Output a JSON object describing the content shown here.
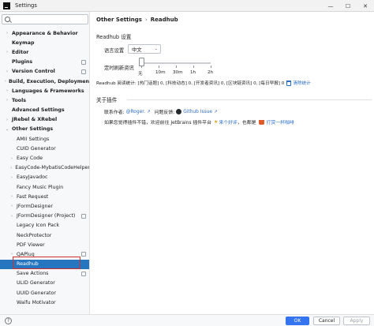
{
  "window": {
    "title": "Settings",
    "minimize_glyph": "—",
    "maximize_glyph": "☐",
    "close_glyph": "✕"
  },
  "sidebar": {
    "search": {
      "value": "",
      "placeholder": "Q"
    },
    "items": [
      {
        "label": "Appearance & Behavior",
        "bold": true,
        "level": 0,
        "arrow": "›",
        "project": false
      },
      {
        "label": "Keymap",
        "bold": true,
        "level": 0,
        "arrow": "",
        "project": false
      },
      {
        "label": "Editor",
        "bold": true,
        "level": 0,
        "arrow": "›",
        "project": false
      },
      {
        "label": "Plugins",
        "bold": true,
        "level": 0,
        "arrow": "",
        "project": true
      },
      {
        "label": "Version Control",
        "bold": true,
        "level": 0,
        "arrow": "›",
        "project": true
      },
      {
        "label": "Build, Execution, Deployment",
        "bold": true,
        "level": 0,
        "arrow": "›",
        "project": false
      },
      {
        "label": "Languages & Frameworks",
        "bold": true,
        "level": 0,
        "arrow": "›",
        "project": false
      },
      {
        "label": "Tools",
        "bold": true,
        "level": 0,
        "arrow": "›",
        "project": false
      },
      {
        "label": "Advanced Settings",
        "bold": true,
        "level": 0,
        "arrow": "",
        "project": false
      },
      {
        "label": "JRebel & XRebel",
        "bold": true,
        "level": 0,
        "arrow": "›",
        "project": false
      },
      {
        "label": "Other Settings",
        "bold": true,
        "level": 0,
        "arrow": "⌄",
        "project": false
      },
      {
        "label": "AMII Settings",
        "bold": false,
        "level": 1,
        "arrow": "",
        "project": false
      },
      {
        "label": "CUID Generator",
        "bold": false,
        "level": 1,
        "arrow": "",
        "project": false
      },
      {
        "label": "Easy Code",
        "bold": false,
        "level": 1,
        "arrow": "›",
        "project": false
      },
      {
        "label": "EasyCode-MybatisCodeHelper",
        "bold": false,
        "level": 1,
        "arrow": "›",
        "project": false
      },
      {
        "label": "EasyJavadoc",
        "bold": false,
        "level": 1,
        "arrow": "›",
        "project": false
      },
      {
        "label": "Fancy Music Plugin",
        "bold": false,
        "level": 1,
        "arrow": "",
        "project": false
      },
      {
        "label": "Fast Request",
        "bold": false,
        "level": 1,
        "arrow": "›",
        "project": false
      },
      {
        "label": "JFormDesigner",
        "bold": false,
        "level": 1,
        "arrow": "›",
        "project": false
      },
      {
        "label": "JFormDesigner (Project)",
        "bold": false,
        "level": 1,
        "arrow": "›",
        "project": true
      },
      {
        "label": "Legacy Icon Pack",
        "bold": false,
        "level": 1,
        "arrow": "",
        "project": false
      },
      {
        "label": "NeckProtector",
        "bold": false,
        "level": 1,
        "arrow": "",
        "project": false
      },
      {
        "label": "PDF Viewer",
        "bold": false,
        "level": 1,
        "arrow": "",
        "project": false
      },
      {
        "label": "QAPlug",
        "bold": false,
        "level": 1,
        "arrow": "›",
        "project": true
      },
      {
        "label": "Readhub",
        "bold": false,
        "level": 1,
        "arrow": "",
        "project": false,
        "selected": true
      },
      {
        "label": "Save Actions",
        "bold": false,
        "level": 1,
        "arrow": "",
        "project": true
      },
      {
        "label": "ULID Generator",
        "bold": false,
        "level": 1,
        "arrow": "",
        "project": false
      },
      {
        "label": "UUID Generator",
        "bold": false,
        "level": 1,
        "arrow": "",
        "project": false
      },
      {
        "label": "Waifu Motivator",
        "bold": false,
        "level": 1,
        "arrow": "",
        "project": false
      }
    ]
  },
  "main": {
    "breadcrumb": {
      "parent": "Other Settings",
      "separator": "›",
      "current": "Readhub"
    },
    "settings_section_title": "Readhub 设置",
    "language": {
      "label": "语言设置",
      "value": "中文",
      "chevron": "⌄"
    },
    "refresh": {
      "label": "定时刷新资讯",
      "selected_index": 0,
      "ticks": [
        "无",
        "10m",
        "30m",
        "1h",
        "2h"
      ]
    },
    "stats": {
      "text": "Readhub 阅读统计: [热门话题] 0, [科技动态] 0, [开发者资讯] 0, [区块链资讯] 0, [每日早报] 0",
      "clear_link": "清除统计"
    },
    "about": {
      "title": "关于插件",
      "contact_label": "联系作者:",
      "author_link": "@Roger.",
      "ext_glyph": "↗",
      "feedback_label": "问题反馈:",
      "issue_link": "Github Issue",
      "support_prefix": "如果您觉得插件不错，欢迎前往 JetBrains 插件平台",
      "rate_link": "来个好评",
      "rate_suffix": "，也都是",
      "coffee_link": "打赏一杯咖啡",
      "star_glyph": "★"
    }
  },
  "footer": {
    "help_glyph": "?",
    "ok_label": "OK",
    "cancel_label": "Cancel",
    "apply_label": "Apply"
  }
}
